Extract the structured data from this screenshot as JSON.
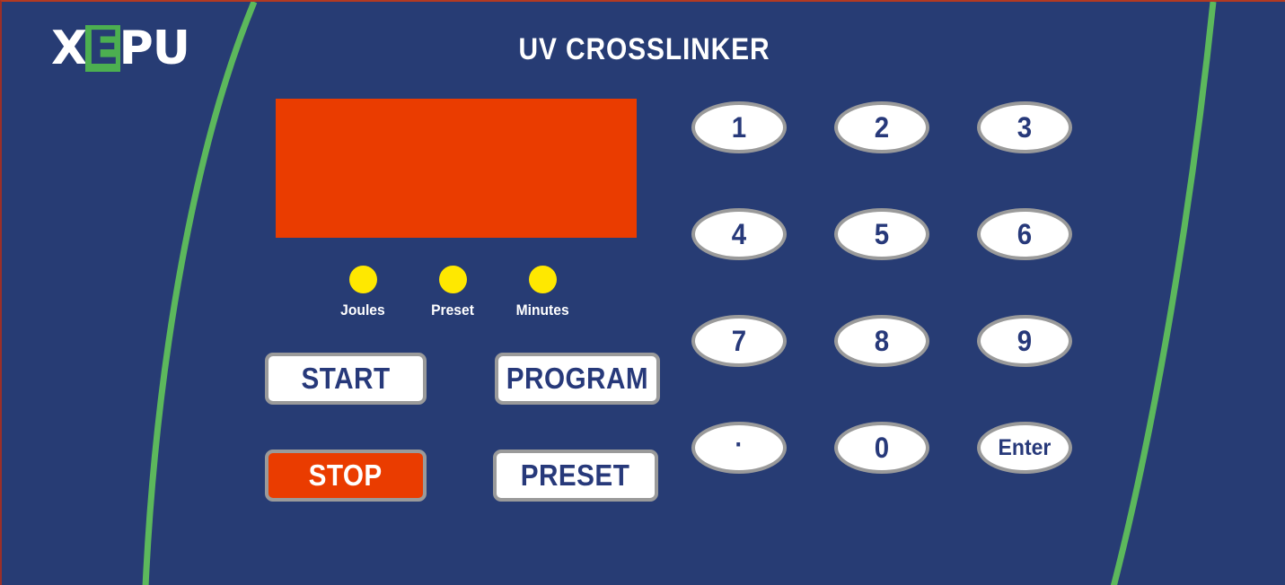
{
  "device": {
    "title": "UV CROSSLINKER",
    "brand": {
      "letters": [
        "X",
        "E",
        "P",
        "U"
      ],
      "boxed_letter_index": 1,
      "box_color": "#4caf50",
      "text_color": "#ffffff"
    },
    "colors": {
      "panel_background": "#273c74",
      "accent_orange": "#ea3c00",
      "accent_green": "#4caf50",
      "led_yellow": "#ffe800",
      "button_face": "#ffffff",
      "button_border": "#9a9a9a",
      "button_text": "#27397a"
    }
  },
  "display": {
    "value": "",
    "placeholder": ""
  },
  "indicators": [
    {
      "label": "Joules",
      "color": "#ffe800",
      "state": "on"
    },
    {
      "label": "Preset",
      "color": "#ffe800",
      "state": "on"
    },
    {
      "label": "Minutes",
      "color": "#ffe800",
      "state": "on"
    }
  ],
  "controls": {
    "start": "START",
    "program": "PROGRAM",
    "stop": "STOP",
    "preset": "PRESET"
  },
  "keypad": {
    "keys": [
      {
        "label": "1",
        "name": "key-1"
      },
      {
        "label": "2",
        "name": "key-2"
      },
      {
        "label": "3",
        "name": "key-3"
      },
      {
        "label": "4",
        "name": "key-4"
      },
      {
        "label": "5",
        "name": "key-5"
      },
      {
        "label": "6",
        "name": "key-6"
      },
      {
        "label": "7",
        "name": "key-7"
      },
      {
        "label": "8",
        "name": "key-8"
      },
      {
        "label": "9",
        "name": "key-9"
      },
      {
        "label": "·",
        "name": "key-decimal"
      },
      {
        "label": "0",
        "name": "key-0"
      },
      {
        "label": "Enter",
        "name": "key-enter"
      }
    ]
  }
}
